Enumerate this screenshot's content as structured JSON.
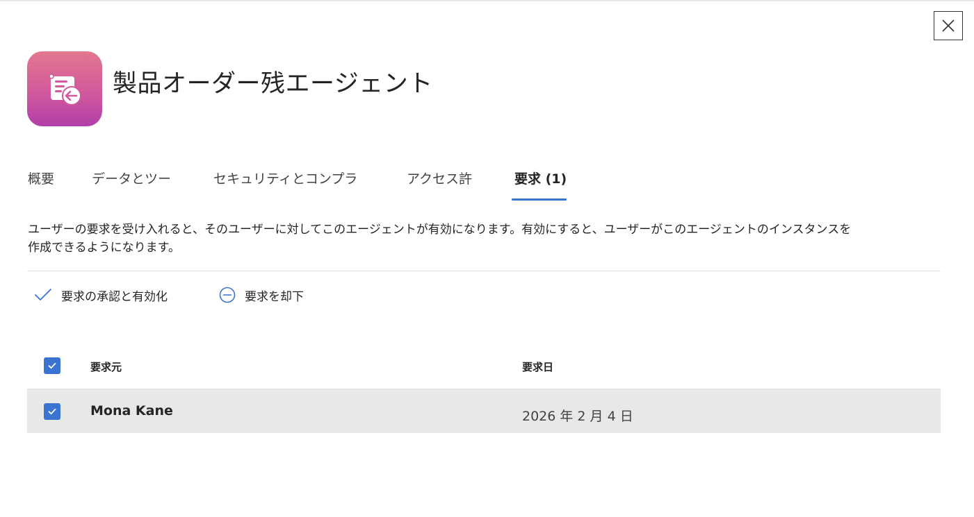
{
  "panel": {
    "title": "製品オーダー残エージェント",
    "close_icon": "close-icon",
    "app_icon": "order-backlog-agent-icon",
    "app_icon_colors": [
      "#e2788e",
      "#d2589c",
      "#b040a8"
    ]
  },
  "tabs": [
    {
      "label": "概要"
    },
    {
      "label": "データとツー"
    },
    {
      "label": "セキュリティとコンプラ"
    },
    {
      "label": "アクセス許"
    },
    {
      "label": "要求 (1)",
      "active": true
    }
  ],
  "description": "ユーザーの要求を受け入れると、そのユーザーに対してこのエージェントが有効になります。有効にすると、ユーザーがこのエージェントのインスタンスを作成できるようになります。",
  "commands": {
    "approve_label": "要求の承認と有効化",
    "reject_label": "要求を却下",
    "approve_icon": "checkmark-icon",
    "reject_icon": "minus-circle-icon"
  },
  "table": {
    "columns": {
      "from": "要求元",
      "date": "要求日"
    },
    "header_checked": true,
    "rows": [
      {
        "from": "Mona Kane",
        "date": "2026 年 2 月 4 日",
        "checked": true
      }
    ]
  },
  "colors": {
    "accent": "#3a73d0",
    "selected_row": "#e8e8e8"
  }
}
